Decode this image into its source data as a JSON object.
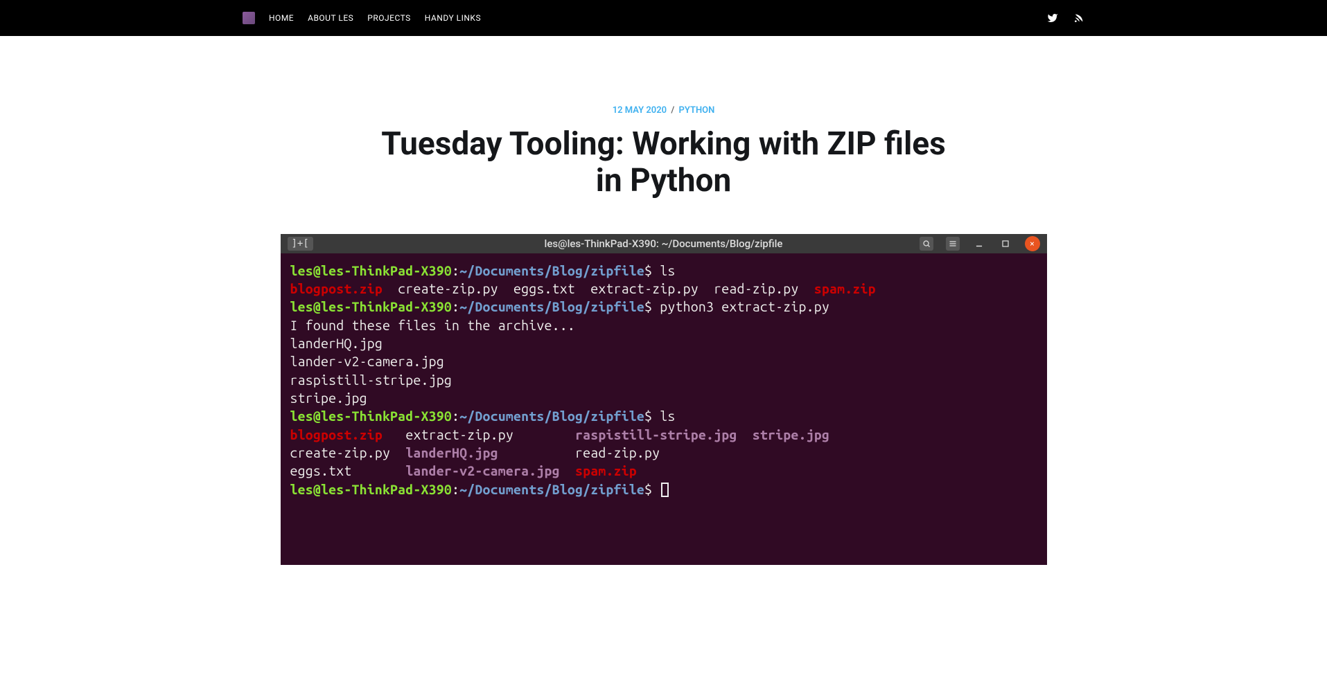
{
  "nav": {
    "items": [
      "HOME",
      "ABOUT LES",
      "PROJECTS",
      "HANDY LINKS"
    ]
  },
  "post": {
    "date": "12 MAY 2020",
    "sep": "/",
    "category": "PYTHON",
    "title": "Tuesday Tooling: Working with ZIP files in Python"
  },
  "terminal": {
    "titlebar": {
      "tab_icon": "]+[",
      "title": "les@les-ThinkPad-X390: ~/Documents/Blog/zipfile",
      "close": "×"
    },
    "prompt": {
      "user": "les@les-ThinkPad-X390",
      "colon": ":",
      "path": "~/Documents/Blog/zipfile",
      "dollar": "$"
    },
    "cmd1": "ls",
    "ls1": {
      "a": "blogpost.zip",
      "b": "create-zip.py",
      "c": "eggs.txt",
      "d": "extract-zip.py",
      "e": "read-zip.py",
      "f": "spam.zip"
    },
    "cmd2": "python3 extract-zip.py",
    "output": {
      "l1": "I found these files in the archive...",
      "l2": "landerHQ.jpg",
      "l3": "lander-v2-camera.jpg",
      "l4": "raspistill-stripe.jpg",
      "l5": "stripe.jpg"
    },
    "cmd3": "ls",
    "ls2": {
      "r1a": "blogpost.zip",
      "r1b": "extract-zip.py",
      "r1c": "raspistill-stripe.jpg",
      "r1d": "stripe.jpg",
      "r2a": "create-zip.py",
      "r2b": "landerHQ.jpg",
      "r2c": "read-zip.py",
      "r3a": "eggs.txt",
      "r3b": "lander-v2-camera.jpg",
      "r3c": "spam.zip"
    }
  }
}
